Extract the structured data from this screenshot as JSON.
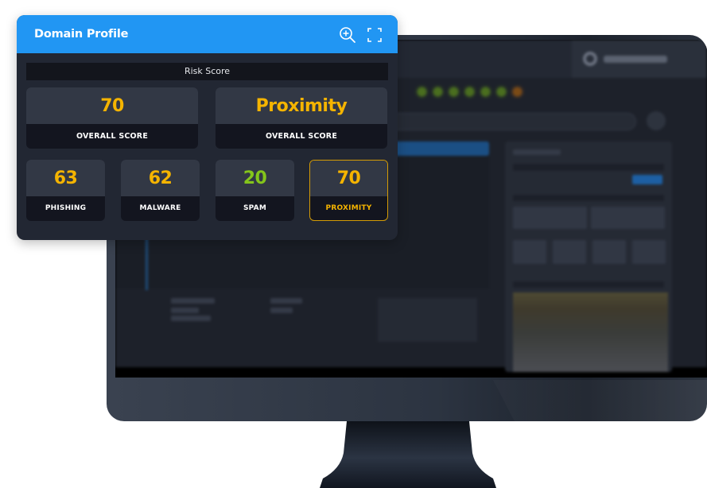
{
  "widget": {
    "title": "Domain Profile",
    "header_icons": [
      "zoom-in-icon",
      "fullscreen-icon"
    ],
    "section_label": "Risk Score",
    "overall": [
      {
        "value": "70",
        "label": "OVERALL SCORE"
      },
      {
        "value": "Proximity",
        "label": "OVERALL SCORE"
      }
    ],
    "components": [
      {
        "value": "63",
        "label": "PHISHING",
        "color": "#f5b400"
      },
      {
        "value": "62",
        "label": "MALWARE",
        "color": "#f5b400"
      },
      {
        "value": "20",
        "label": "SPAM",
        "color": "#84c51b"
      },
      {
        "value": "70",
        "label": "PROXIMITY",
        "color": "#f5b400",
        "highlighted": true
      }
    ]
  },
  "colors": {
    "header_blue": "#2196f3",
    "score_amber": "#f5b400",
    "score_green": "#84c51b",
    "card_bg": "#222733"
  },
  "background_app": {
    "status_dots": [
      "green",
      "green",
      "green",
      "green",
      "green",
      "green",
      "orange"
    ]
  }
}
